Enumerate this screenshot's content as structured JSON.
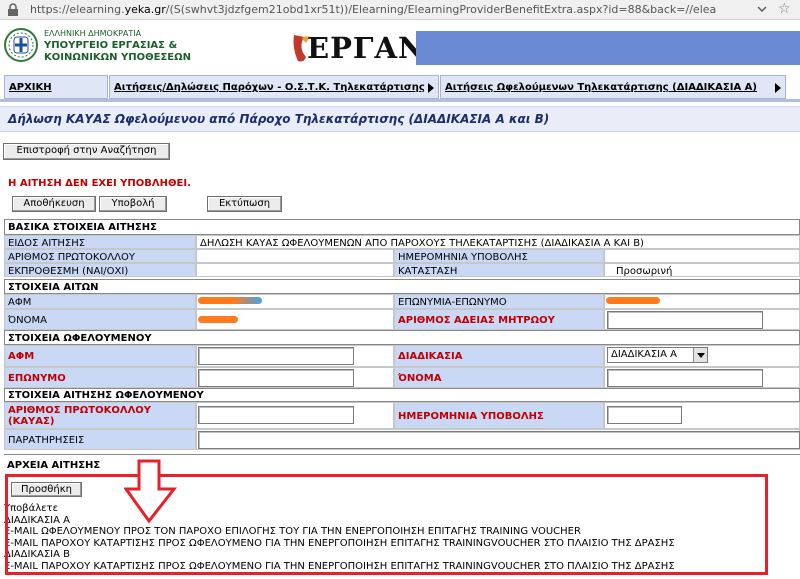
{
  "browser": {
    "url_prefix": "https://elearning.",
    "url_domain": "yeka.gr",
    "url_rest": "/(S(swhvt3jdzfgem21obd1xr51t))/Elearning/ElearningProviderBenefitExtra.aspx?id=88&back=//elea"
  },
  "header": {
    "ministry_line1": "ΕΛΛΗΝΙΚΗ ΔΗΜΟΚΡΑΤΙΑ",
    "ministry_line2": "ΥΠΟΥΡΓΕΙΟ ΕΡΓΑΣΙΑΣ &",
    "ministry_line3": "ΚΟΙΝΩΝΙΚΩΝ ΥΠΟΘΕΣΕΩΝ",
    "logo_text": "ΕΡΓΑΝΗ",
    "brand_color": "#6a8bd3"
  },
  "nav": {
    "home": "ΑΡΧΙΚΗ",
    "item2": "Αιτήσεις/Δηλώσεις Παρόχων - Ο.Σ.Τ.Κ. Τηλεκατάρτισης",
    "item3": "Αιτήσεις Ωφελούμενων Τηλεκατάρτισης (ΔΙΑΔΙΚΑΣΙΑ Α)"
  },
  "page": {
    "title": "Δήλωση ΚΑΥΑΣ Ωφελούμενου από Πάροχο Τηλεκατάρτισης (ΔΙΑΔΙΚΑΣΙΑ Α και Β)",
    "back_button": "Επιστροφή στην Αναζήτηση",
    "status_message": "Η ΑΙΤΗΣΗ ΔΕΝ ΕΧΕΙ ΥΠΟΒΛΗΘΕΙ.",
    "save_button": "Αποθήκευση",
    "submit_button": "Υποβολή",
    "print_button": "Εκτύπωση"
  },
  "basic": {
    "section_title": "ΒΑΣΙΚΑ ΣΤΟΙΧΕΙΑ ΑΙΤΗΣΗΣ",
    "type_label": "ΕΙΔΟΣ ΑΙΤΗΣΗΣ",
    "type_value": "ΔΗΛΩΣΗ ΚΑΥΑΣ ΩΦΕΛΟΥΜΕΝΩΝ ΑΠΟ ΠΑΡΟΧΟΥΣ ΤΗΛΕΚΑΤΑΡΤΙΣΗΣ (ΔΙΑΔΙΚΑΣΙΑ Α ΚΑΙ Β)",
    "protocol_label": "ΑΡΙΘΜΟΣ ΠΡΩΤΟΚΟΛΛΟΥ",
    "submit_date_label": "ΗΜΕΡΟΜΗΝΙΑ ΥΠΟΒΟΛΗΣ",
    "late_label": "ΕΚΠΡΟΘΕΣΜΗ (ΝΑΙ/ΟΧΙ)",
    "status_label": "ΚΑΤΑΣΤΑΣΗ",
    "status_value": "Προσωρινή"
  },
  "applicant": {
    "section_title": "ΣΤΟΙΧΕΙΑ ΑΙΤΩΝ",
    "afm_label": "ΑΦΜ",
    "company_label": "ΕΠΩΝΥΜΙΑ-ΕΠΩΝΥΜΟ",
    "name_label": "ΌΝΟΜΑ",
    "license_label": "ΑΡΙΘΜΟΣ ΑΔΕΙΑΣ ΜΗΤΡΩΟΥ"
  },
  "beneficiary": {
    "section_title": "ΣΤΟΙΧΕΙΑ ΩΦΕΛΟΥΜΕΝΟΥ",
    "afm_label": "ΑΦΜ",
    "procedure_label": "ΔΙΑΔΙΚΑΣΙΑ",
    "procedure_value": "ΔΙΑΔΙΚΑΣΙΑ Α",
    "surname_label": "ΕΠΩΝΥΜΟ",
    "name_label": "ΌΝΟΜΑ"
  },
  "request": {
    "section_title": "ΣΤΟΙΧΕΙΑ ΑΙΤΗΣΗΣ ΩΦΕΛΟΥΜΕΝΟΥ",
    "protocol_label_1": "ΑΡΙΘΜΟΣ ΠΡΩΤΟΚΟΛΛΟΥ",
    "protocol_label_2": "(ΚΑΥΑΣ)",
    "date_label": "ΗΜΕΡΟΜΗΝΙΑ ΥΠΟΒΟΛΗΣ",
    "notes_label": "ΠΑΡΑΤΗΡΗΣΕΙΣ"
  },
  "files": {
    "section_title": "ΑΡΧΕΙΑ ΑΙΤΗΣΗΣ",
    "add_button": "Προσθήκη",
    "lines": [
      "Υποβάλετε",
      "ΔΙΑΔΙΚΑΣΙΑ Α",
      "E-MAIL ΩΦΕΛΟΥΜΕΝΟΥ ΠΡΟΣ ΤΟΝ ΠΑΡΟΧΟ ΕΠΙΛΟΓΗΣ ΤΟΥ ΓΙΑ ΤΗΝ ΕΝΕΡΓΟΠΟΙΗΣΗ ΕΠΙΤΑΓΗΣ TRAINING VOUCHER",
      "E-MAIL ΠΑΡΟΧΟΥ ΚΑΤΑΡΤΙΣΗΣ ΠΡΟΣ ΩΦΕΛΟΥΜΕΝΟ ΓΙΑ ΤΗΝ ΕΝΕΡΓΟΠΟΙΗΣΗ ΕΠΙΤΑΓΗΣ TRAININGVOUCHER ΣΤΟ ΠΛΑΙΣΙΟ ΤΗΣ ΔΡΑΣΗΣ",
      "ΔΙΑΔΙΚΑΣΙΑ Β",
      "E-MAIL ΠΑΡΟΧΟΥ ΚΑΤΑΡΤΙΣΗΣ ΠΡΟΣ ΩΦΕΛΟΥΜΕΝΟ ΓΙΑ ΤΗΝ ΕΝΕΡΓΟΠΟΙΗΣΗ ΕΠΙΤΑΓΗΣ TRAININGVOUCHER ΣΤΟ ΠΛΑΙΣΙΟ ΤΗΣ ΔΡΑΣΗΣ"
    ]
  },
  "colors": {
    "label_bg": "#c8d8f5",
    "required_text": "#c00000",
    "highlight": "#e8202a"
  }
}
